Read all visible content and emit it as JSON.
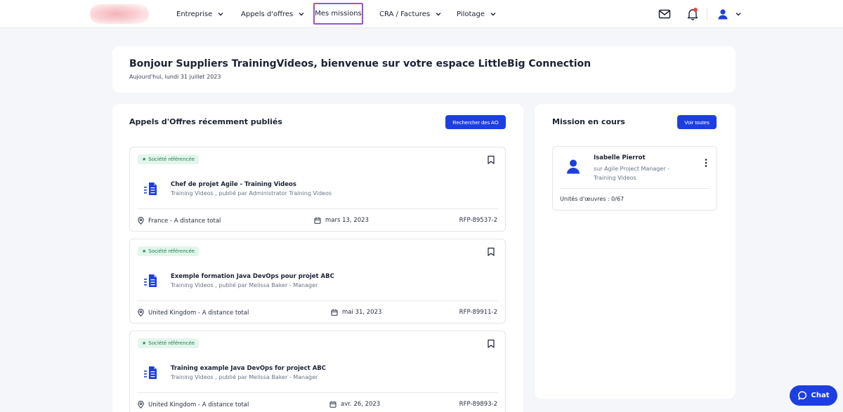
{
  "nav": {
    "items": [
      {
        "label": "Entreprise"
      },
      {
        "label": "Appels d'offres"
      },
      {
        "label": "Mes missions"
      },
      {
        "label": "CRA / Factures"
      },
      {
        "label": "Pilotage"
      }
    ]
  },
  "welcome": {
    "title": "Bonjour Suppliers TrainingVideos, bienvenue sur votre espace LittleBig Connection",
    "date": "Aujourd'hui, lundi 31 juillet 2023"
  },
  "ao_panel": {
    "title": "Appels d'Offres récemment publiés",
    "search_button": "Rechercher des AO",
    "items": [
      {
        "badge": "Société référencée",
        "title": "Chef de projet Agile - Training Videos",
        "subtitle": "Training Videos , publié par Administrator Training Videos",
        "location": "France - A distance total",
        "date": "mars 13, 2023",
        "ref": "RFP-89537-2"
      },
      {
        "badge": "Société référencée",
        "title": "Exemple formation Java DevOps pour projet ABC",
        "subtitle": "Training Videos , publié par Melissa Baker - Manager",
        "location": "United Kingdom - A distance total",
        "date": "mai 31, 2023",
        "ref": "RFP-89911-2"
      },
      {
        "badge": "Société référencée",
        "title": "Training example Java DevOps for project ABC",
        "subtitle": "Training Videos , publié par Melissa Baker - Manager",
        "location": "United Kingdom - A distance total",
        "date": "avr. 26, 2023",
        "ref": "RFP-89893-2"
      }
    ]
  },
  "mission_panel": {
    "title": "Mission en cours",
    "see_all_button": "Voir toutes",
    "mission": {
      "name": "Isabelle Pierrot",
      "role": "sur Agile Project Manager - Training Videos",
      "units": "Unités d'œuvres : 0/67"
    }
  },
  "chat": {
    "label": "Chat"
  },
  "colors": {
    "primary": "#1d3fe0",
    "active_outline": "#9b4fe0",
    "badge_bg": "#e3f6ec",
    "badge_text": "#1a7f4b"
  }
}
